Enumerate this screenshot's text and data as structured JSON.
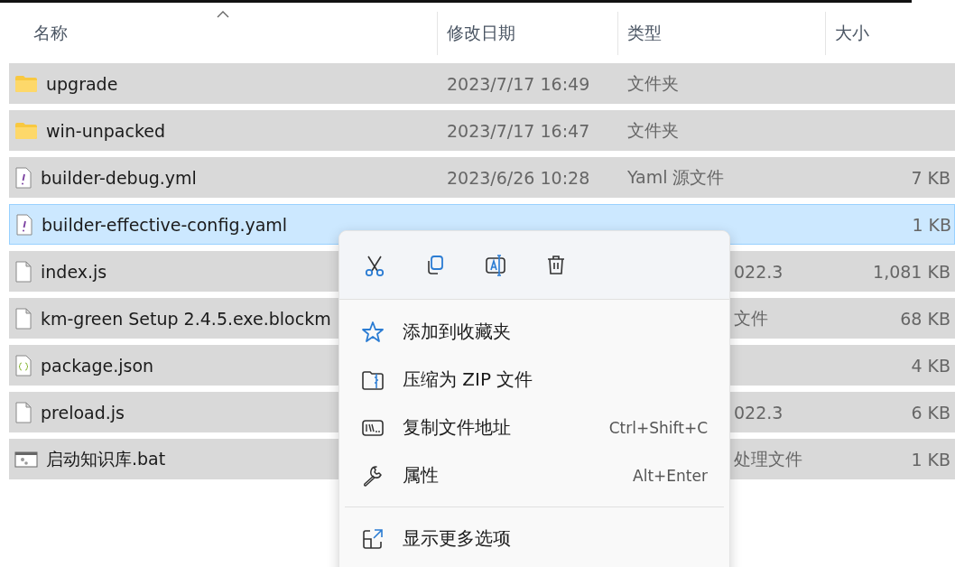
{
  "columns": [
    {
      "label": "名称",
      "sorted": true
    },
    {
      "label": "修改日期",
      "sorted": false
    },
    {
      "label": "类型",
      "sorted": false
    },
    {
      "label": "大小",
      "sorted": false
    }
  ],
  "rows": [
    {
      "kind": "folder",
      "name": "upgrade",
      "date": "2023/7/17 16:49",
      "type": "文件夹",
      "selected": true,
      "focused": false
    },
    {
      "kind": "folder",
      "name": "win-unpacked",
      "date": "2023/7/17 16:47",
      "type": "文件夹",
      "selected": true,
      "focused": false
    },
    {
      "kind": "yaml",
      "name": "builder-debug.yml",
      "date": "2023/6/26 10:28",
      "type": "Yaml 源文件",
      "size": "7 KB",
      "selected": true,
      "focused": false
    },
    {
      "kind": "yaml",
      "name": "builder-effective-config.yaml",
      "size": "1 KB",
      "selected": true,
      "focused": true
    },
    {
      "kind": "file",
      "name": "index.js",
      "type": "022.3",
      "size": "1,081 KB",
      "selected": true,
      "focused": false
    },
    {
      "kind": "file",
      "name": "km-green Setup 2.4.5.exe.blockm",
      "type": "文件",
      "size": "68 KB",
      "selected": true,
      "focused": false
    },
    {
      "kind": "json",
      "name": "package.json",
      "size": "4 KB",
      "selected": true,
      "focused": false
    },
    {
      "kind": "file",
      "name": "preload.js",
      "type": "022.3",
      "size": "6 KB",
      "selected": true,
      "focused": false
    },
    {
      "kind": "bat",
      "name": "启动知识库.bat",
      "type": "处理文件",
      "size": "1 KB",
      "selected": true,
      "focused": false
    }
  ],
  "context_menu": {
    "toolbar": [
      {
        "kind": "cut"
      },
      {
        "kind": "copy"
      },
      {
        "kind": "rename"
      },
      {
        "kind": "delete"
      }
    ],
    "items": [
      {
        "kind": "star",
        "label": "添加到收藏夹"
      },
      {
        "kind": "zip",
        "label": "压缩为 ZIP 文件"
      },
      {
        "kind": "path",
        "label": "复制文件地址",
        "shortcut": "Ctrl+Shift+C"
      },
      {
        "kind": "wrench",
        "label": "属性",
        "shortcut": "Alt+Enter"
      }
    ],
    "more_items": [
      {
        "kind": "more",
        "label": "显示更多选项"
      }
    ]
  }
}
